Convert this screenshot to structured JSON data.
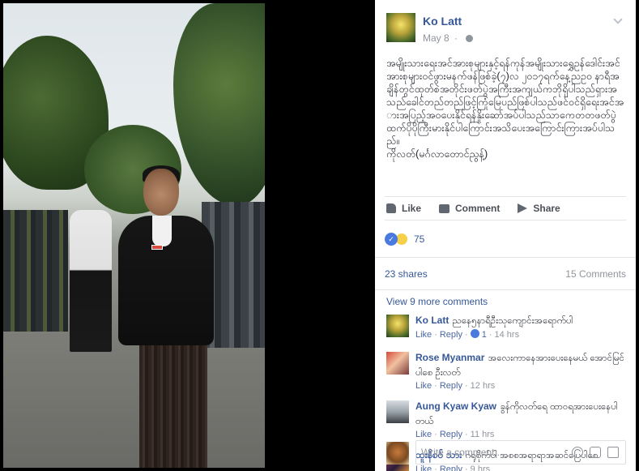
{
  "post": {
    "author": "Ko Latt",
    "date": "May 8",
    "text": "အမျိုးသားရေးအင်အားစုများနှင့်ရန်ကုန်အမျိုးသားရွှေဥန်ဒေါင်းအင်အားစုများဝင်ဖွားမနက်ဖန်ဖြစ်ခဲ့(၇)လ ၂၀၁၇ရက်နေ့ညဥ၀ နာရီအချိန်တွင်ထုတ်စဲအတိုင်းဖတ်ပွဲအကြီးအကျယ်ကဘိုရှိပါသည်ရှားအသည်ခေါင်တည်တည်ဖြင့်ကြုံမြေပည်ဖြစ်ပါသည်ဖင်ဝင်ရှိရေးအင်အားအပြည့်အဝပေးနိုင်ရန်နှိုးဆော်အပ်ပါသည်သာကေတတဖတ်ပွဲထက်ပိုပိုကြီးမားနိုင်ပါကြောင်းအသိပေးအကြောင်းကြားအပ်ပါသည်။\nကိုလတ်(မင်္ဂလာတောင်ညွန့်)"
  },
  "actions": {
    "like_label": "Like",
    "comment_label": "Comment",
    "share_label": "Share"
  },
  "reactions": {
    "count": "75"
  },
  "stats": {
    "shares": "23 shares",
    "comments": "15 Comments"
  },
  "view_more": "View 9 more comments",
  "comments": [
    {
      "author": "Ko Latt",
      "text": "ညနေ၅နာရီဦးသုကျောင်းအရောက်ပါ",
      "like": "Like",
      "reply": "Reply",
      "likes": "1",
      "time": "14 hrs"
    },
    {
      "author": "Rose Myanmar",
      "text": "အလေးကာနေအားပေးနေမယ် အောင်မြင်ပါစေ ဦးလတ်",
      "like": "Like",
      "reply": "Reply",
      "time": "12 hrs"
    },
    {
      "author": "Aung Kyaw Kyaw",
      "text": "ခွန်ကိုလတ်ရေ ထာဝရအားပေးနေပါတယ်",
      "like": "Like",
      "reply": "Reply",
      "time": "11 hrs"
    },
    {
      "author": "ထူးနီစဝ် သား",
      "text": "ဂရုစိုက်ပါ အစစအရာရာအဆင်ပြေပါစေ",
      "like": "Like",
      "reply": "Reply",
      "time": "9 hrs"
    }
  ],
  "write_comment": {
    "placeholder": "Write a comment..."
  },
  "colors": {
    "link_blue": "#365899",
    "like_blue": "#4a7ae0",
    "meta_gray": "#90949c"
  }
}
